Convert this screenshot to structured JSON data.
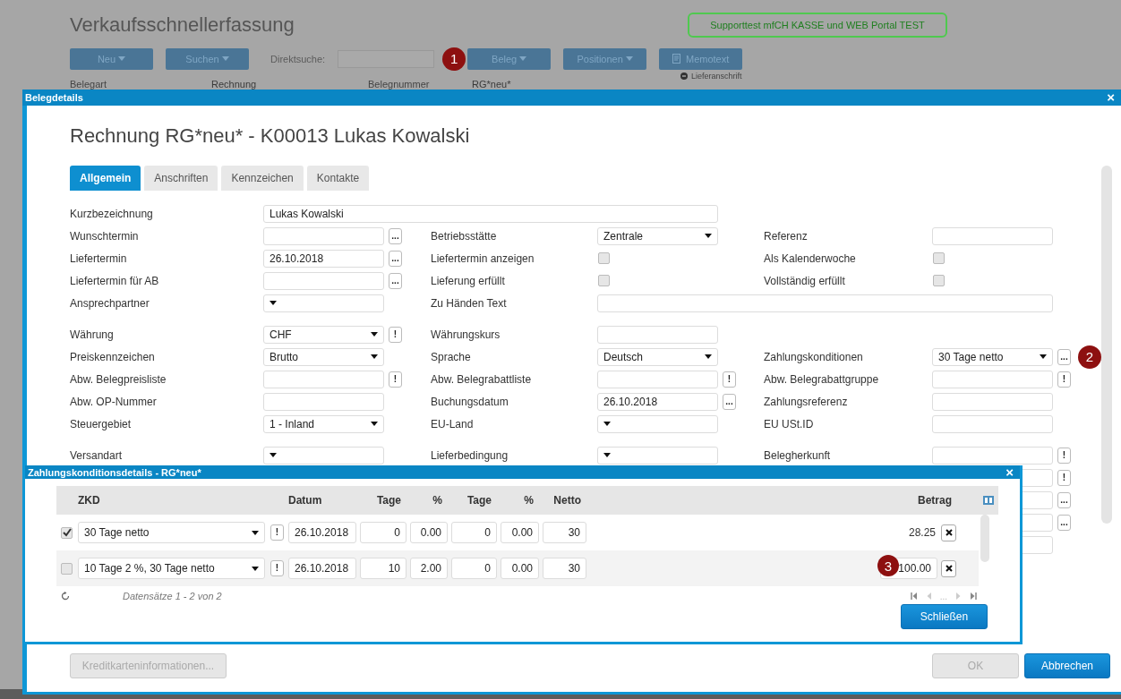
{
  "background_app": {
    "title": "Verkaufsschnellerfassung",
    "notice": "Supporttest mfCH KASSE und WEB Portal TEST",
    "toolbar": [
      {
        "kind": "menu",
        "label": "Neu"
      },
      {
        "kind": "menu",
        "label": "Suchen"
      },
      {
        "kind": "search",
        "label": "Direktsuche:"
      },
      {
        "kind": "menu",
        "label": "Beleg",
        "marker": "1"
      },
      {
        "kind": "menu",
        "label": "Positionen"
      },
      {
        "kind": "note",
        "label": "Memotext"
      }
    ],
    "info": [
      {
        "label": "Belegart",
        "value": "Rechnung"
      },
      {
        "label": "Belegnummer",
        "value": "RG*neu*"
      }
    ],
    "delivery_address": "Lieferanschrift"
  },
  "document_dialog": {
    "title": "Belegdetails",
    "close": "×",
    "heading": "Rechnung RG*neu* - K00013 Lukas Kowalski",
    "tabs": [
      {
        "label": "Allgemein",
        "selected": true
      },
      {
        "label": "Anschriften",
        "selected": false
      },
      {
        "label": "Kennzeichen",
        "selected": false
      },
      {
        "label": "Kontakte",
        "selected": false
      }
    ],
    "groups": [
      [
        {
          "left": {
            "label": "Kurzbezeichnung",
            "control": {
              "kind": "wide-text",
              "value": "Lukas Kowalski"
            }
          }
        },
        {
          "left": {
            "label": "Wunschtermin",
            "control": {
              "kind": "text"
            },
            "button": "..."
          },
          "middle": {
            "label": "Betriebsstätte",
            "control": {
              "kind": "select",
              "value": "Zentrale"
            }
          },
          "right": {
            "label": "Referenz",
            "control": {
              "kind": "text"
            }
          }
        },
        {
          "left": {
            "label": "Liefertermin",
            "control": {
              "kind": "text",
              "value": "26.10.2018"
            },
            "button": "..."
          },
          "middle": {
            "label": "Liefertermin anzeigen",
            "control": {
              "kind": "checkbox",
              "checked": false
            }
          },
          "right": {
            "label": "Als Kalenderwoche",
            "control": {
              "kind": "checkbox",
              "checked": false
            }
          }
        },
        {
          "left": {
            "label": "Liefertermin für AB",
            "control": {
              "kind": "text"
            },
            "button": "..."
          },
          "middle": {
            "label": "Lieferung erfüllt",
            "control": {
              "kind": "checkbox",
              "checked": false
            }
          },
          "right": {
            "label": "Vollständig erfüllt",
            "control": {
              "kind": "checkbox",
              "checked": false
            }
          }
        },
        {
          "left": {
            "label": "Ansprechpartner",
            "control": {
              "kind": "select"
            }
          },
          "middle": {
            "label": "Zu Händen Text",
            "control": {
              "kind": "wide-text"
            }
          }
        }
      ],
      [
        {
          "left": {
            "label": "Währung",
            "control": {
              "kind": "select",
              "value": "CHF"
            },
            "button": "!"
          },
          "middle": {
            "label": "Währungskurs",
            "control": {
              "kind": "text"
            }
          }
        },
        {
          "left": {
            "label": "Preiskennzeichen",
            "control": {
              "kind": "select",
              "value": "Brutto"
            }
          },
          "middle": {
            "label": "Sprache",
            "control": {
              "kind": "select",
              "value": "Deutsch"
            }
          },
          "right": {
            "label": "Zahlungskonditionen",
            "control": {
              "kind": "select",
              "value": "30 Tage netto"
            },
            "button": "...",
            "marker": "2"
          }
        },
        {
          "left": {
            "label": "Abw. Belegpreisliste",
            "control": {
              "kind": "text"
            },
            "button": "!"
          },
          "middle": {
            "label": "Abw. Belegrabattliste",
            "control": {
              "kind": "text"
            },
            "button": "!"
          },
          "right": {
            "label": "Abw. Belegrabattgruppe",
            "control": {
              "kind": "text"
            },
            "button": "!"
          }
        },
        {
          "left": {
            "label": "Abw. OP-Nummer",
            "control": {
              "kind": "text"
            }
          },
          "middle": {
            "label": "Buchungsdatum",
            "control": {
              "kind": "text",
              "value": "26.10.2018"
            },
            "button": "..."
          },
          "right": {
            "label": "Zahlungsreferenz",
            "control": {
              "kind": "text"
            }
          }
        },
        {
          "left": {
            "label": "Steuergebiet",
            "control": {
              "kind": "select",
              "value": "1 - Inland"
            }
          },
          "middle": {
            "label": "EU-Land",
            "control": {
              "kind": "select"
            }
          },
          "right": {
            "label": "EU USt.ID",
            "control": {
              "kind": "text"
            }
          }
        }
      ],
      [
        {
          "left": {
            "label": "Versandart",
            "control": {
              "kind": "select"
            }
          },
          "middle": {
            "label": "Lieferbedingung",
            "control": {
              "kind": "select"
            }
          },
          "right": {
            "label": "Belegherkunft",
            "control": {
              "kind": "text"
            },
            "button": "!"
          }
        },
        {
          "right": {
            "control": {
              "kind": "text"
            },
            "button": "!"
          }
        },
        {
          "right": {
            "control": {
              "kind": "text"
            },
            "button": "..."
          }
        },
        {
          "right": {
            "control": {
              "kind": "text"
            },
            "button": "..."
          }
        },
        {
          "right": {
            "control": {
              "kind": "select"
            }
          }
        }
      ]
    ],
    "footer_buttons": [
      {
        "label": "Kreditkarteninformationen...",
        "disabled": true
      },
      {
        "label": "OK",
        "disabled": true
      },
      {
        "label": "Abbrechen",
        "disabled": false
      }
    ]
  },
  "payment_dialog": {
    "title": "Zahlungskonditionsdetails - RG*neu*",
    "close": "×",
    "columns": [
      "ZKD",
      "Datum",
      "Tage",
      "%",
      "Tage",
      "%",
      "Netto",
      "Betrag"
    ],
    "rows": [
      {
        "checked": true,
        "condition": "30 Tage netto",
        "alert": "!",
        "date": "26.10.2018",
        "days_1": "0",
        "percent_1": "0.00",
        "days_2": "0",
        "percent_2": "0.00",
        "net_days": "30",
        "amount": "28.25",
        "amount_editable": false
      },
      {
        "checked": false,
        "condition": "10 Tage 2 %, 30 Tage netto",
        "alert": "!",
        "date": "26.10.2018",
        "days_1": "10",
        "percent_1": "2.00",
        "days_2": "0",
        "percent_2": "0.00",
        "net_days": "30",
        "amount": "100.00",
        "amount_editable": true,
        "marker": "3"
      }
    ],
    "record_info": "Datensätze 1 - 2 von 2",
    "pager_gap": "...",
    "close_button": "Schließen"
  }
}
